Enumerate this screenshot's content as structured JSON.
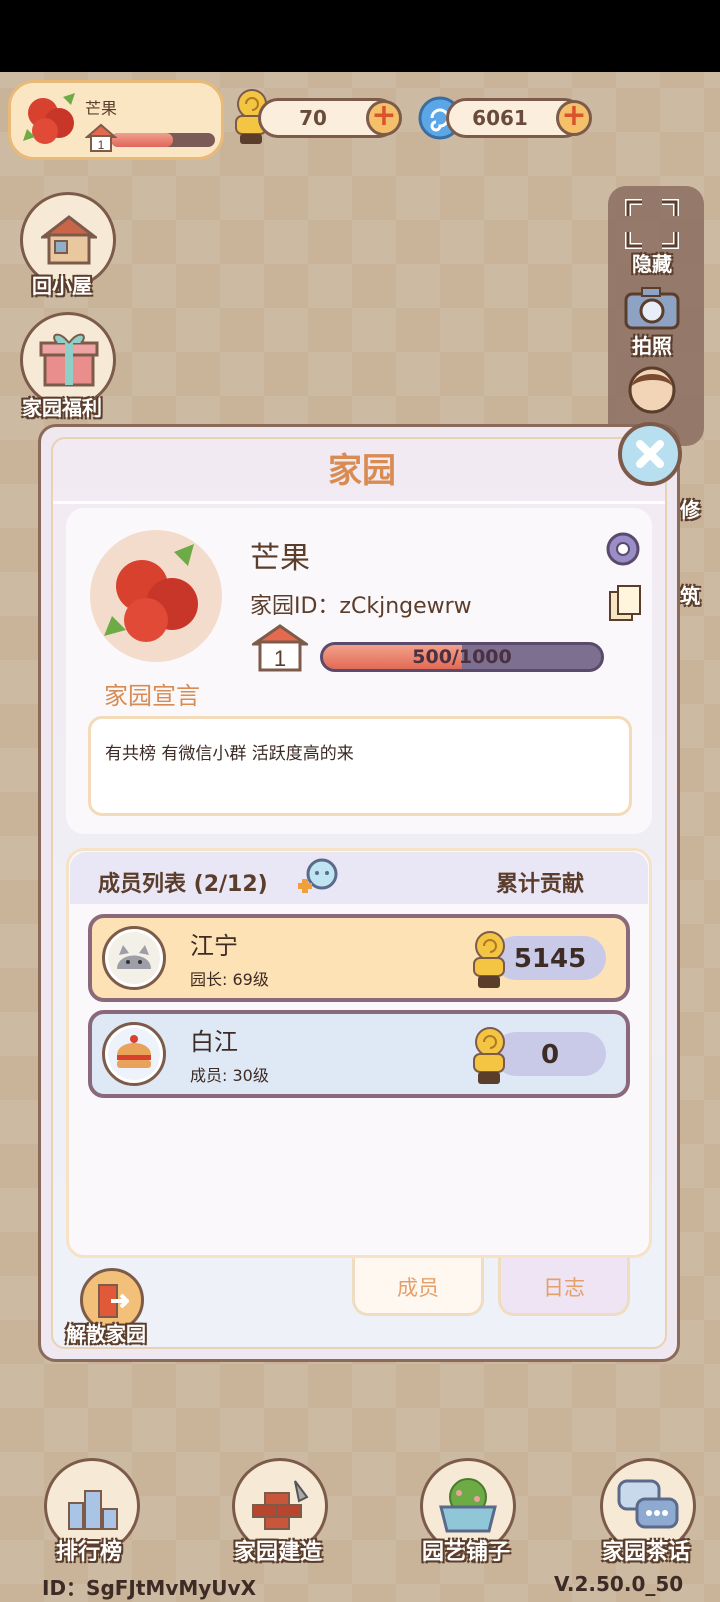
{
  "top_bar": {
    "player_name": "芒果",
    "house_level": "1",
    "xp_fraction": 0.6,
    "coins": "70",
    "gems": "6061"
  },
  "side_buttons": {
    "home": "回小屋",
    "welfare": "家园福利",
    "hide": "隐藏",
    "photo": "拍照",
    "decorate": "修",
    "build": "筑"
  },
  "dialog": {
    "title": "家园",
    "garden_name": "芒果",
    "garden_id": "家园ID：zCkjngewrw",
    "level": "1",
    "xp_text": "500/1000",
    "xp_fraction": 0.5,
    "declaration_label": "家园宣言",
    "declaration_text": "有共榜 有微信小群 活跃度高的来",
    "member_list_title": "成员列表 (2/12)",
    "contribution_header": "累计贡献",
    "members": [
      {
        "name": "江宁",
        "role": "园长: 69级",
        "contribution": "5145"
      },
      {
        "name": "白江",
        "role": "成员: 30级",
        "contribution": "0"
      }
    ],
    "tabs": {
      "members": "成员",
      "log": "日志"
    },
    "disband": "解散家园"
  },
  "bottom_nav": {
    "ranking": "排行榜",
    "build": "家园建造",
    "shop": "园艺铺子",
    "chat": "家园茶话"
  },
  "footer": {
    "id": "ID：SgFJtMvMyUvX",
    "version": "V.2.50.0_50"
  },
  "colors": {
    "accent_orange": "#d88b52",
    "progress_red": "#e26a55",
    "outline_brown": "#7d5b4a"
  }
}
